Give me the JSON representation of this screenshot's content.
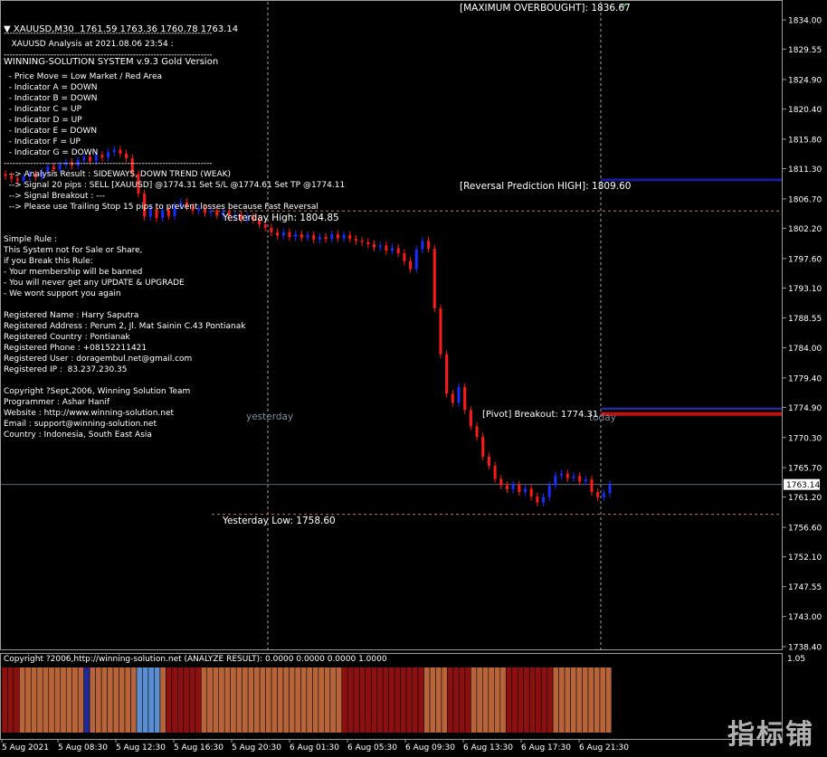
{
  "header": {
    "symbol_line": "XAUUSD,M30  1761.59 1763.36 1760.78 1763.14",
    "system_title": "WINNING-SOLUTION SYSTEM v.9.3 Gold Version"
  },
  "info_lines": [
    "-----------------------------------------------------------------------",
    "   XAUUSD Analysis at 2021.08.06 23:54 :",
    "-----------------------------------------------------------------------",
    "",
    "  - Price Move = Low Market / Red Area",
    "  - Indicator A = DOWN",
    "  - Indicator B = DOWN",
    "  - Indicator C = UP",
    "  - Indicator D = UP",
    "  - Indicator E = DOWN",
    "  - Indicator F = UP",
    "  - Indicator G = DOWN",
    "-----------------------------------------------------------------------",
    "  --> Analysis Result : SIDEWAYS, DOWN TREND (WEAK)",
    "  --> Signal 20 pips : SELL [XAUUSD] @1774.31 Set S/L @1774.61 Set TP @1774.11",
    "  --> Signal Breakout : ---",
    "  --> Please use Trailing Stop 15 pips to prevent losses because Fast Reversal",
    "",
    "",
    "Simple Rule :",
    "This System not for Sale or Share,",
    "if you Break this Rule:",
    "- Your membership will be banned",
    "- You will never get any UPDATE & UPGRADE",
    "- We wont support you again",
    "",
    "Registered Name : Harry Saputra",
    "Registered Address : Perum 2, Jl. Mat Sainin C.43 Pontianak",
    "Registered Country : Pontianak",
    "Registered Phone : +08152211421",
    "Registered User : doragembul.net@gmail.com",
    "Registered IP :  83.237.230.35",
    "",
    "Copyright ?Sept,2006, Winning Solution Team",
    "Programmer : Ashar Hanif",
    "Website : http://www.winning-solution.net",
    "Email : support@winning-solution.net",
    "Country : Indonesia, South East Asia"
  ],
  "labels": {
    "max_overbought": "[MAXIMUM OVERBOUGHT]: 1836.67",
    "reversal_high": "[Reversal Prediction HIGH]: 1809.60",
    "yesterday_high": "Yesterday High: 1804.85",
    "yesterday_low": "Yesterday Low: 1758.60",
    "yesterday": "yesterday",
    "today": "today",
    "overlap_text": "[Pivot] Breakout: 1774.31",
    "current_price": "1763.14"
  },
  "indicator": {
    "title": "Copyright ?2006,http://winning-solution.net (ANALYZE RESULT): 0.0000 0.0000 0.0000 1.0000",
    "scale_label": "1.05",
    "colors": {
      "dark_red": "#8b1010",
      "orange": "#b8643a",
      "blue": "#1a2a9a",
      "light_blue": "#5a8ed0"
    }
  },
  "price_axis": [
    "1834.00",
    "1829.55",
    "1824.90",
    "1820.40",
    "1815.80",
    "1811.30",
    "1806.70",
    "1802.20",
    "1797.60",
    "1793.10",
    "1788.55",
    "1784.00",
    "1779.40",
    "1774.90",
    "1770.30",
    "1765.70",
    "1761.20",
    "1756.60",
    "1752.10",
    "1747.55",
    "1743.00",
    "1738.40"
  ],
  "time_axis": [
    "5 Aug 2021",
    "5 Aug 08:30",
    "5 Aug 12:30",
    "5 Aug 16:30",
    "5 Aug 20:30",
    "6 Aug 01:30",
    "6 Aug 05:30",
    "6 Aug 09:30",
    "6 Aug 13:30",
    "6 Aug 17:30",
    "6 Aug 21:30"
  ],
  "colors": {
    "up_bar": "#1a2cff",
    "down_bar": "#ff1a1a",
    "grid": "#333333",
    "yesterday_line": "#c08040",
    "reversal_line": "#1a1a9a",
    "today_red": "#c01010"
  },
  "watermark": "指标铺",
  "chart_data": {
    "type": "line",
    "title": "XAUUSD,M30",
    "ylim": [
      1738.4,
      1836.67
    ],
    "series": [
      {
        "name": "XAUUSD,M30",
        "values": [
          1810.2,
          1809.8,
          1809.5,
          1810.1,
          1810.5,
          1810.0,
          1810.8,
          1811.6,
          1811.2,
          1811.9,
          1812.3,
          1811.8,
          1812.6,
          1813.1,
          1812.5,
          1813.4,
          1813.0,
          1813.8,
          1814.2,
          1813.6,
          1812.9,
          1810.5,
          1807.5,
          1804.0,
          1805.2,
          1803.8,
          1805.0,
          1804.1,
          1805.6,
          1806.2,
          1805.5,
          1804.9,
          1805.3,
          1804.6,
          1804.9,
          1804.2,
          1804.7,
          1804.1,
          1804.3,
          1803.6,
          1804.0,
          1803.5,
          1802.8,
          1802.3,
          1801.6,
          1801.1,
          1801.6,
          1800.9,
          1801.3,
          1800.8,
          1801.2,
          1800.5,
          1800.9,
          1800.6,
          1801.3,
          1800.7,
          1801.2,
          1800.6,
          1800.3,
          1800.1,
          1799.8,
          1799.3,
          1799.6,
          1798.8,
          1799.2,
          1798.4,
          1797.2,
          1796.0,
          1799.0,
          1800.3,
          1799.1,
          1790.0,
          1783.0,
          1777.0,
          1775.6,
          1778.0,
          1774.5,
          1772.0,
          1770.4,
          1767.4,
          1766.0,
          1764.0,
          1763.0,
          1762.4,
          1763.1,
          1762.0,
          1762.5,
          1761.3,
          1760.4,
          1761.2,
          1763.0,
          1764.5,
          1764.8,
          1764.1,
          1764.4,
          1763.6,
          1763.9,
          1762.0,
          1761.2,
          1761.8,
          1763.14
        ]
      }
    ]
  }
}
